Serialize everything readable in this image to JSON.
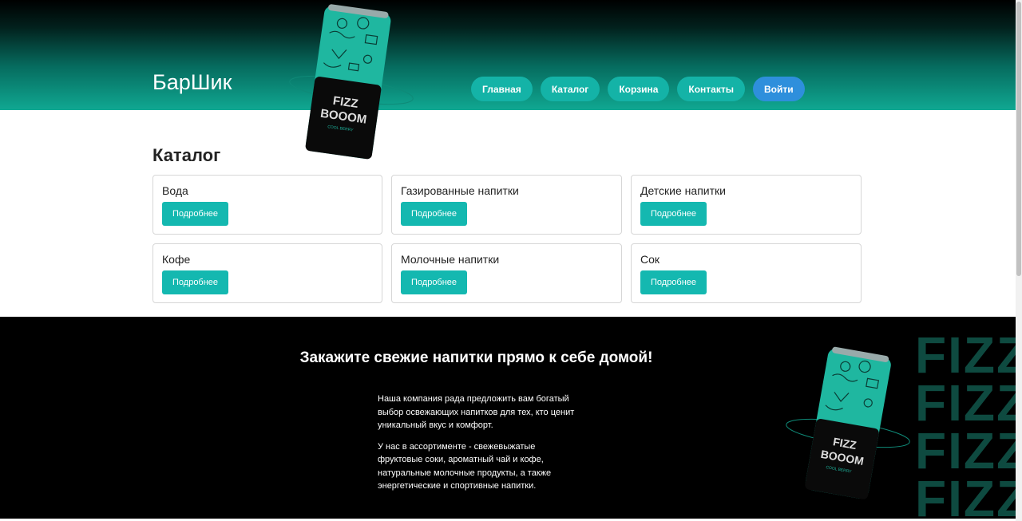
{
  "header": {
    "brand": "БарШик",
    "nav": [
      "Главная",
      "Каталог",
      "Корзина",
      "Контакты"
    ],
    "login": "Войти"
  },
  "catalog": {
    "title": "Каталог",
    "button_label": "Подробнее",
    "items": [
      "Вода",
      "Газированные напитки",
      "Детские напитки",
      "Кофе",
      "Молочные напитки",
      "Сок"
    ]
  },
  "promo": {
    "title": "Закажите свежие напитки прямо к себе домой!",
    "paragraph1": "Наша компания рада предложить вам богатый выбор освежающих напитков для тех, кто ценит уникальный вкус и комфорт.",
    "paragraph2": "У нас в ассортименте - свежевыжатые фруктовые соки, ароматный чай и кофе, натуральные молочные продукты, а также энергетические и спортивные напитки.",
    "fizz_wall": [
      "FIZZ",
      "FIZZ",
      "FIZZ",
      "FIZZ"
    ]
  },
  "can": {
    "line1": "FIZZ",
    "line2": "BOOOM",
    "sub": "COOL BERRY"
  },
  "colors": {
    "accent": "#14b8b0",
    "login": "#2e8fdc",
    "can_green": "#1fb7a0"
  }
}
